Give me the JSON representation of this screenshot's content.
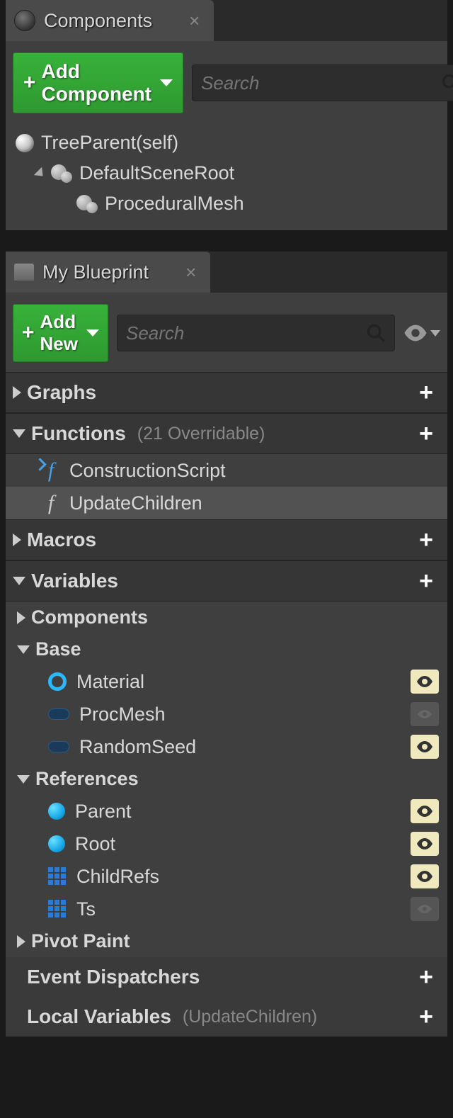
{
  "components": {
    "tab_title": "Components",
    "add_button": "Add Component",
    "search_placeholder": "Search",
    "tree": {
      "root": "TreeParent(self)",
      "scene_root": "DefaultSceneRoot",
      "child1": "ProceduralMesh"
    }
  },
  "blueprint": {
    "tab_title": "My Blueprint",
    "add_button": "Add New",
    "search_placeholder": "Search",
    "sections": {
      "graphs": "Graphs",
      "functions": "Functions",
      "functions_sub": "(21 Overridable)",
      "macros": "Macros",
      "variables": "Variables",
      "event_dispatchers": "Event Dispatchers",
      "local_variables": "Local Variables",
      "local_variables_sub": "(UpdateChildren)"
    },
    "functions": {
      "f1": "ConstructionScript",
      "f2": "UpdateChildren"
    },
    "var_groups": {
      "components": "Components",
      "base": "Base",
      "references": "References",
      "pivot_paint": "Pivot Paint"
    },
    "vars": {
      "material": "Material",
      "procmesh": "ProcMesh",
      "randomseed": "RandomSeed",
      "parent": "Parent",
      "root": "Root",
      "childrefs": "ChildRefs",
      "ts": "Ts"
    }
  }
}
